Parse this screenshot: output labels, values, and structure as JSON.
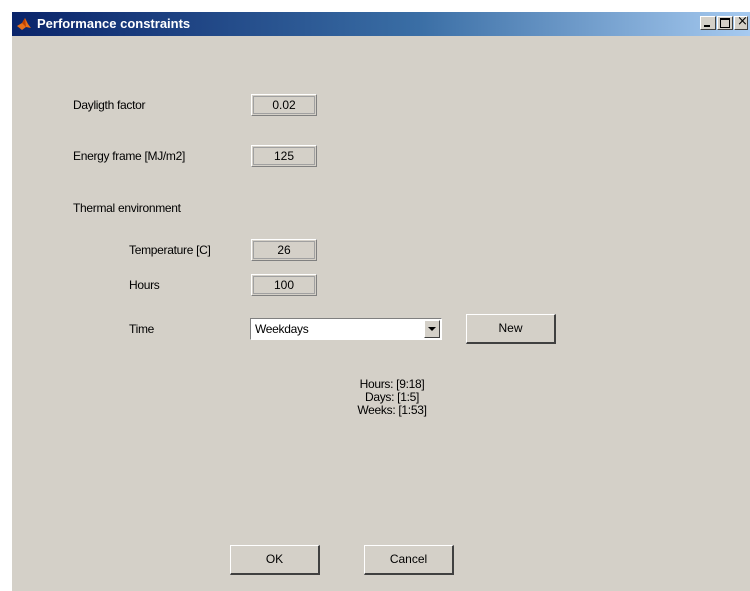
{
  "window": {
    "title": "Performance constraints",
    "icon": "matlab-icon"
  },
  "form": {
    "daylight_label": "Dayligth factor",
    "daylight_value": "0.02",
    "energy_label": "Energy frame [MJ/m2]",
    "energy_value": "125",
    "thermal_label": "Thermal environment",
    "temperature_label": "Temperature [C]",
    "temperature_value": "26",
    "hours_label": "Hours",
    "hours_value": "100",
    "time_label": "Time",
    "time_selected": "Weekdays",
    "new_button": "New"
  },
  "info": {
    "hours": "Hours: [9:18]",
    "days": "Days: [1:5]",
    "weeks": "Weeks: [1:53]"
  },
  "buttons": {
    "ok": "OK",
    "cancel": "Cancel"
  }
}
